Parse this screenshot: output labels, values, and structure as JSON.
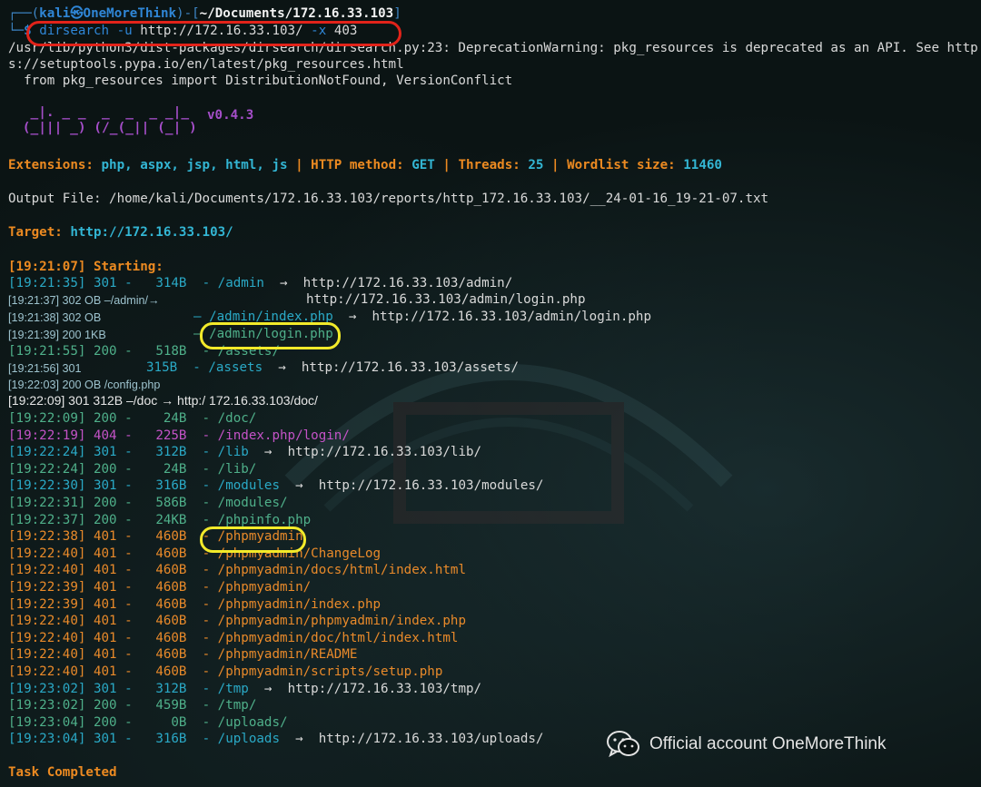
{
  "prompt": {
    "user_host": "kali㉿OneMoreThink",
    "cwd": "~/Documents/172.16.33.103",
    "symbol": "$"
  },
  "command": {
    "name": "dirsearch",
    "flag_u": "-u",
    "url": "http://172.16.33.103/",
    "flag_x": "-x",
    "code": "403"
  },
  "warning": {
    "line1": "/usr/lib/python3/dist-packages/dirsearch/dirsearch.py:23: DeprecationWarning: pkg_resources is deprecated as an API. See http",
    "line2": "s://setuptools.pypa.io/en/latest/pkg_resources.html",
    "line3": "  from pkg_resources import DistributionNotFound, VersionConflict"
  },
  "banner": {
    "version": "v0.4.3"
  },
  "config": {
    "extensions_label": "Extensions:",
    "extensions": "php, aspx, jsp, html, js",
    "method_label": "HTTP method:",
    "method": "GET",
    "threads_label": "Threads:",
    "threads": "25",
    "wordlist_label": "Wordlist size:",
    "wordlist": "11460"
  },
  "output_file": "Output File: /home/kali/Documents/172.16.33.103/reports/http_172.16.33.103/__24-01-16_19-21-07.txt",
  "target": {
    "label": "Target:",
    "url": "http://172.16.33.103/"
  },
  "starting": "[19:21:07] Starting:",
  "results": [
    {
      "ts": "[19:21:35]",
      "code": "301",
      "size": "314B",
      "path": "/admin",
      "arrow": "→",
      "redir": "http://172.16.33.103/admin/",
      "color": "cyan"
    },
    {
      "ts": "[19:22:09]",
      "code": "200",
      "size": "24B",
      "path": "/doc/",
      "color": "grn"
    },
    {
      "ts": "[19:22:19]",
      "code": "404",
      "size": "225B",
      "path": "/index.php/login/",
      "color": "mag"
    },
    {
      "ts": "[19:22:24]",
      "code": "301",
      "size": "312B",
      "path": "/lib",
      "arrow": "→",
      "redir": "http://172.16.33.103/lib/",
      "color": "cyan"
    },
    {
      "ts": "[19:22:24]",
      "code": "200",
      "size": "24B",
      "path": "/lib/",
      "color": "grn"
    },
    {
      "ts": "[19:22:30]",
      "code": "301",
      "size": "316B",
      "path": "/modules",
      "arrow": "→",
      "redir": "http://172.16.33.103/modules/",
      "color": "cyan"
    },
    {
      "ts": "[19:22:31]",
      "code": "200",
      "size": "586B",
      "path": "/modules/",
      "color": "grn"
    },
    {
      "ts": "[19:22:37]",
      "code": "200",
      "size": "24KB",
      "path": "/phpinfo.php",
      "color": "grn"
    },
    {
      "ts": "[19:22:38]",
      "code": "401",
      "size": "460B",
      "path": "/phpmyadmin",
      "color": "org"
    },
    {
      "ts": "[19:22:40]",
      "code": "401",
      "size": "460B",
      "path": "/phpmyadmin/ChangeLog",
      "color": "org"
    },
    {
      "ts": "[19:22:40]",
      "code": "401",
      "size": "460B",
      "path": "/phpmyadmin/docs/html/index.html",
      "color": "org"
    },
    {
      "ts": "[19:22:39]",
      "code": "401",
      "size": "460B",
      "path": "/phpmyadmin/",
      "color": "org"
    },
    {
      "ts": "[19:22:39]",
      "code": "401",
      "size": "460B",
      "path": "/phpmyadmin/index.php",
      "color": "org"
    },
    {
      "ts": "[19:22:40]",
      "code": "401",
      "size": "460B",
      "path": "/phpmyadmin/phpmyadmin/index.php",
      "color": "org"
    },
    {
      "ts": "[19:22:40]",
      "code": "401",
      "size": "460B",
      "path": "/phpmyadmin/doc/html/index.html",
      "color": "org"
    },
    {
      "ts": "[19:22:40]",
      "code": "401",
      "size": "460B",
      "path": "/phpmyadmin/README",
      "color": "org"
    },
    {
      "ts": "[19:22:40]",
      "code": "401",
      "size": "460B",
      "path": "/phpmyadmin/scripts/setup.php",
      "color": "org"
    },
    {
      "ts": "[19:23:02]",
      "code": "301",
      "size": "312B",
      "path": "/tmp",
      "arrow": "→",
      "redir": "http://172.16.33.103/tmp/",
      "color": "cyan"
    },
    {
      "ts": "[19:23:02]",
      "code": "200",
      "size": "459B",
      "path": "/tmp/",
      "color": "grn"
    },
    {
      "ts": "[19:23:04]",
      "code": "200",
      "size": "0B",
      "path": "/uploads/",
      "color": "grn"
    },
    {
      "ts": "[19:23:04]",
      "code": "301",
      "size": "316B",
      "path": "/uploads",
      "arrow": "→",
      "redir": "http://172.16.33.103/uploads/",
      "color": "cyan"
    }
  ],
  "partial": {
    "login_redirect": "http://172.16.33.103/admin/login.php",
    "l3_ts": "[19:21:37] 302 OB –/admin/→",
    "l4_ts": "[19:21:38] 302 OB",
    "l4_path": "– /admin/index.php",
    "l4_arrow": "→",
    "l4_redir": "http://172.16.33.103/admin/login.php",
    "l5_ts": "[19:21:39] 200 1KB",
    "l5_dash": "–",
    "l5_path": "/admin/login.php",
    "l6_ts": "[19:21:55]",
    "l6_code": "200",
    "l6_size": "518B",
    "l6_path": "/assets/",
    "l7_ts": "[19:21:56] 301",
    "l7_size": "315B",
    "l7_path": "/assets",
    "l7_arrow": "→",
    "l7_redir": "http://172.16.33.103/assets/",
    "l8": "[19:22:03] 200 OB /config.php",
    "l9": "[19:22:09] 301 312B –/doc → http:/ 172.16.33.103/doc/"
  },
  "task_completed": "Task Completed",
  "watermark": "Official account OneMoreThink",
  "colors": {
    "background": "#0b1414",
    "blue": "#2f86d6",
    "orange": "#ec8a21",
    "cyan": "#2aa9c6",
    "green": "#4fb08a",
    "magenta": "#c453c7",
    "purple": "#a54ec9",
    "red_ring": "#e2231a",
    "yellow_ring": "#f2ea2a"
  },
  "icons": {
    "wechat": "wechat-icon"
  }
}
